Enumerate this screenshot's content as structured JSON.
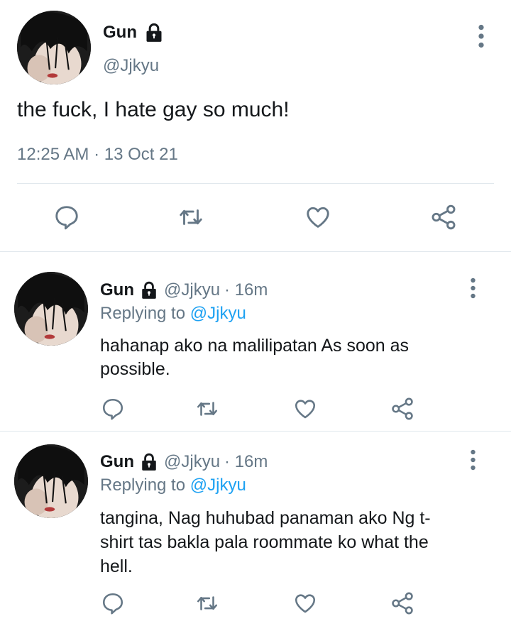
{
  "main_tweet": {
    "display_name": "Gun",
    "handle": "@Jjkyu",
    "text": "the fuck, I hate gay so much!",
    "timestamp": "12:25 AM · 13 Oct 21"
  },
  "replies": [
    {
      "display_name": "Gun",
      "handle": "@Jjkyu",
      "time": "· 16m",
      "replying_prefix": "Replying to",
      "replying_handle": "@Jjkyu",
      "text_lines": [
        "hahanap ako na malilipatan As soon as",
        "possible."
      ]
    },
    {
      "display_name": "Gun",
      "handle": "@Jjkyu",
      "time": "· 16m",
      "replying_prefix": "Replying to",
      "replying_handle": "@Jjkyu",
      "text_lines": [
        "tangina, Nag huhubad panaman ako Ng t-",
        "shirt tas bakla pala roommate ko what the",
        "hell."
      ]
    }
  ],
  "icons": {
    "lock": "lock-icon",
    "more": "more-vertical-icon",
    "reply": "reply-icon",
    "retweet": "retweet-icon",
    "like": "heart-icon",
    "share": "share-icon"
  },
  "colors": {
    "text": "#14171a",
    "muted": "#657786",
    "link": "#1da1f2",
    "divider": "#e1e8ed",
    "icon": "#657786"
  }
}
